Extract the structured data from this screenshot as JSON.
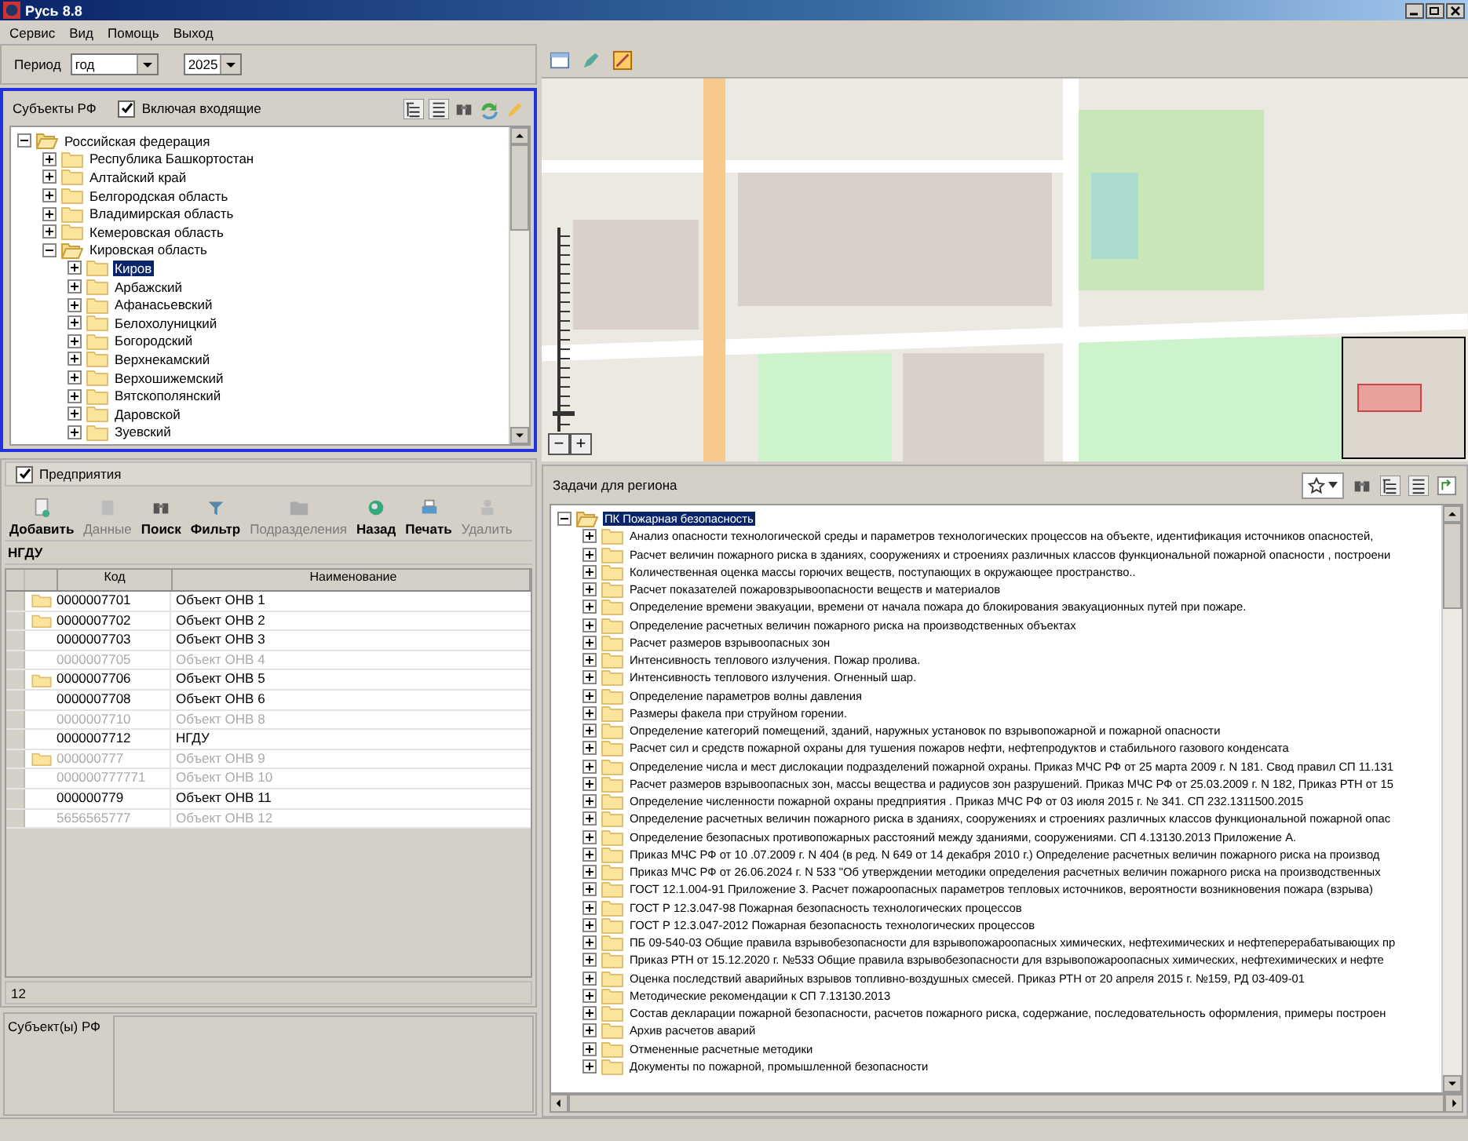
{
  "window": {
    "title": "Русь 8.8"
  },
  "menu": [
    "Сервис",
    "Вид",
    "Помощь",
    "Выход"
  ],
  "period": {
    "label": "Период",
    "type": "год",
    "year": "2025"
  },
  "subjects": {
    "title": "Субъекты РФ",
    "include_incoming": {
      "label": "Включая входящие",
      "checked": true
    },
    "tree": [
      {
        "label": "Российская федерация",
        "expanded": true,
        "selected": false,
        "children": [
          {
            "label": "Республика Башкортостан",
            "expanded": false,
            "selected": false
          },
          {
            "label": "Алтайский край",
            "expanded": false,
            "selected": false
          },
          {
            "label": "Белгородская область",
            "expanded": false,
            "selected": false
          },
          {
            "label": "Владимирская область",
            "expanded": false,
            "selected": false
          },
          {
            "label": "Кемеровская область",
            "expanded": false,
            "selected": false
          },
          {
            "label": "Кировская область",
            "expanded": true,
            "selected": false,
            "children": [
              {
                "label": "Киров",
                "expanded": false,
                "selected": true
              },
              {
                "label": "Арбажский",
                "expanded": false,
                "selected": false
              },
              {
                "label": "Афанасьевский",
                "expanded": false,
                "selected": false
              },
              {
                "label": "Белохолуницкий",
                "expanded": false,
                "selected": false
              },
              {
                "label": "Богородский",
                "expanded": false,
                "selected": false
              },
              {
                "label": "Верхнекамский",
                "expanded": false,
                "selected": false
              },
              {
                "label": "Верхошижемский",
                "expanded": false,
                "selected": false
              },
              {
                "label": "Вятскополянский",
                "expanded": false,
                "selected": false
              },
              {
                "label": "Даровской",
                "expanded": false,
                "selected": false
              },
              {
                "label": "Зуевский",
                "expanded": false,
                "selected": false
              }
            ]
          }
        ]
      }
    ]
  },
  "enterprises": {
    "checkbox": {
      "label": "Предприятия",
      "checked": true
    },
    "toolbar": [
      {
        "kind": "add",
        "label": "Добавить",
        "disabled": false
      },
      {
        "kind": "data",
        "label": "Данные",
        "disabled": true
      },
      {
        "kind": "search",
        "label": "Поиск",
        "disabled": false
      },
      {
        "kind": "filter",
        "label": "Фильтр",
        "disabled": false
      },
      {
        "kind": "divisions",
        "label": "Подразделения",
        "disabled": true
      },
      {
        "kind": "back",
        "label": "Назад",
        "disabled": false
      },
      {
        "kind": "print",
        "label": "Печать",
        "disabled": false
      },
      {
        "kind": "delete",
        "label": "Удалить",
        "disabled": true
      }
    ],
    "group": "НГДУ",
    "columns": [
      "Код",
      "Наименование"
    ],
    "rows": [
      {
        "code": "0000007701",
        "name": "Объект ОНВ 1",
        "folder": true,
        "disabled": false
      },
      {
        "code": "0000007702",
        "name": "Объект ОНВ 2",
        "folder": true,
        "disabled": false
      },
      {
        "code": "0000007703",
        "name": "Объект ОНВ 3",
        "folder": false,
        "disabled": false
      },
      {
        "code": "0000007705",
        "name": "Объект ОНВ 4",
        "folder": false,
        "disabled": true
      },
      {
        "code": "0000007706",
        "name": "Объект ОНВ 5",
        "folder": true,
        "disabled": false
      },
      {
        "code": "0000007708",
        "name": "Объект ОНВ 6",
        "folder": false,
        "disabled": false
      },
      {
        "code": "0000007710",
        "name": "Объект ОНВ 8",
        "folder": false,
        "disabled": true
      },
      {
        "code": "0000007712",
        "name": "НГДУ",
        "folder": false,
        "disabled": false
      },
      {
        "code": "000000777",
        "name": "Объект ОНВ 9",
        "folder": true,
        "disabled": true
      },
      {
        "code": "000000777771",
        "name": "Объект ОНВ 10",
        "folder": false,
        "disabled": true
      },
      {
        "code": "000000779",
        "name": "Объект ОНВ 11",
        "folder": false,
        "disabled": false
      },
      {
        "code": "5656565777",
        "name": "Объект ОНВ 12",
        "folder": false,
        "disabled": true
      }
    ],
    "count": "12"
  },
  "subject_field": {
    "label": "Субъект(ы) РФ"
  },
  "map": {
    "kind": "picture",
    "zoom": {
      "level": 0.08,
      "out": "−",
      "in": "+"
    }
  },
  "tasks": {
    "title": "Задачи для региона",
    "tree": [
      {
        "label": "ПК Пожарная безопасность",
        "expanded": true,
        "selected": true,
        "children": [
          {
            "label": "Анализ опасности технологической среды и параметров технологических процессов на объекте, идентификация источников опасностей,",
            "expanded": false,
            "selected": false
          },
          {
            "label": "Расчет величин пожарного риска в зданиях, сооружениях и строениях различных классов функциональной пожарной опасности , построени",
            "expanded": false,
            "selected": false
          },
          {
            "label": "Количественная оценка массы горючих веществ, поступающих в окружающее пространство..",
            "expanded": false,
            "selected": false
          },
          {
            "label": "Расчет показателей пожаровзрывоопасности веществ и материалов",
            "expanded": false,
            "selected": false
          },
          {
            "label": "Определение времени эвакуации,  времени от начала пожара до блокирования эвакуационных путей при пожаре.",
            "expanded": false,
            "selected": false
          },
          {
            "label": "Определение расчетных величин пожарного риска на производственных объектах",
            "expanded": false,
            "selected": false
          },
          {
            "label": "Расчет размеров взрывоопасных зон",
            "expanded": false,
            "selected": false
          },
          {
            "label": "Интенсивность теплового излучения. Пожар пролива.",
            "expanded": false,
            "selected": false
          },
          {
            "label": "Интенсивность теплового излучения. Огненный шар.",
            "expanded": false,
            "selected": false
          },
          {
            "label": "Определение параметров волны давления",
            "expanded": false,
            "selected": false
          },
          {
            "label": "Размеры факела при струйном горении.",
            "expanded": false,
            "selected": false
          },
          {
            "label": "Определение категорий помещений, зданий, наружных установок по взрывопожарной и пожарной опасности",
            "expanded": false,
            "selected": false
          },
          {
            "label": "Расчет сил и средств пожарной охраны для тушения пожаров нефти, нефтепродуктов и стабильного газового конденсата",
            "expanded": false,
            "selected": false
          },
          {
            "label": "Определение числа и мест дислокации подразделений пожарной охраны. Приказ МЧС РФ от 25 марта 2009 г. N 181. Свод правил СП 11.131",
            "expanded": false,
            "selected": false
          },
          {
            "label": "Расчет размеров взрывоопасных зон, массы вещества и радиусов зон разрушений.  Приказ МЧС РФ от 25.03.2009 г. N 182, Приказ РТН от 15",
            "expanded": false,
            "selected": false
          },
          {
            "label": "Определение численности пожарной охраны предприятия . Приказ МЧС РФ от 03 июля 2015 г. № 341. СП 232.1311500.2015",
            "expanded": false,
            "selected": false
          },
          {
            "label": "Определение расчетных величин пожарного риска в зданиях, сооружениях и строениях различных классов функциональной пожарной опас",
            "expanded": false,
            "selected": false
          },
          {
            "label": "Определение безопасных противопожарных расстояний между зданиями, сооружениями. СП 4.13130.2013 Приложение А.",
            "expanded": false,
            "selected": false
          },
          {
            "label": "Приказ МЧС РФ от 10 .07.2009 г. N 404  (в ред. N 649 от 14 декабря 2010 г.) Определение расчетных величин пожарного риска на производ",
            "expanded": false,
            "selected": false
          },
          {
            "label": "Приказ МЧС РФ от 26.06.2024 г.  N 533  \"Об утверждении методики определения расчетных величин пожарного риска на производственных",
            "expanded": false,
            "selected": false
          },
          {
            "label": "ГОСТ 12.1.004-91 Приложение 3. Расчет пожароопасных параметров тепловых источников, вероятности возникновения пожара (взрыва)",
            "expanded": false,
            "selected": false
          },
          {
            "label": "ГОСТ Р 12.3.047-98 Пожарная безопасность технологических процессов",
            "expanded": false,
            "selected": false
          },
          {
            "label": "ГОСТ Р 12.3.047-2012 Пожарная безопасность технологических процессов",
            "expanded": false,
            "selected": false
          },
          {
            "label": "ПБ 09-540-03 Общие правила взрывобезопасности для взрывопожароопасных химических, нефтехимических и нефтеперерабатывающих пр",
            "expanded": false,
            "selected": false
          },
          {
            "label": "Приказ РТН от 15.12.2020 г.  №533 Общие правила взрывобезопасности для взрывопожароопасных химических, нефтехимических и нефте",
            "expanded": false,
            "selected": false
          },
          {
            "label": "Оценка последствий аварийных взрывов топливно-воздушных смесей.  Приказ РТН от 20 апреля 2015  г. №159,  РД 03-409-01",
            "expanded": false,
            "selected": false
          },
          {
            "label": "Методические рекомендации к СП 7.13130.2013",
            "expanded": false,
            "selected": false
          },
          {
            "label": "Состав декларации  пожарной безопасности, расчетов пожарного риска, содержание, последовательность оформления,  примеры построен",
            "expanded": false,
            "selected": false
          },
          {
            "label": "Архив расчетов аварий",
            "expanded": false,
            "selected": false
          },
          {
            "label": "Отмененные расчетные методики",
            "expanded": false,
            "selected": false
          },
          {
            "label": "Документы по пожарной, промышленной  безопасности",
            "expanded": false,
            "selected": false
          }
        ]
      }
    ]
  }
}
